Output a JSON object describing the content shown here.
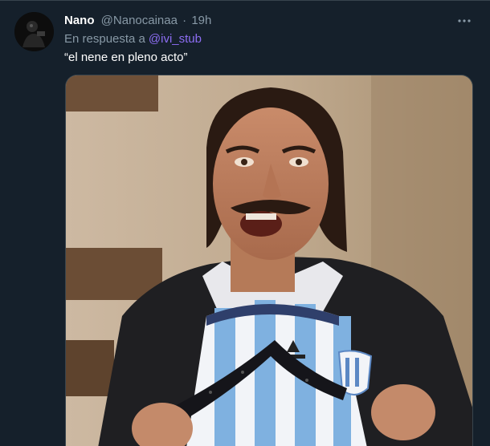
{
  "tweet": {
    "author_name": "Nano",
    "author_handle": "@Nanocainaa",
    "separator": "·",
    "timestamp": "19h",
    "reply_prefix": "En respuesta a",
    "reply_to": "@ivi_stub",
    "text": "“el nene en pleno acto”"
  },
  "icons": {
    "more": "more-dots-icon",
    "avatar": "avatar"
  },
  "colors": {
    "background": "#15202b",
    "primary_text": "#ffffff",
    "secondary_text": "#8899a6",
    "mention": "#8c6df2",
    "border": "#38444d"
  }
}
